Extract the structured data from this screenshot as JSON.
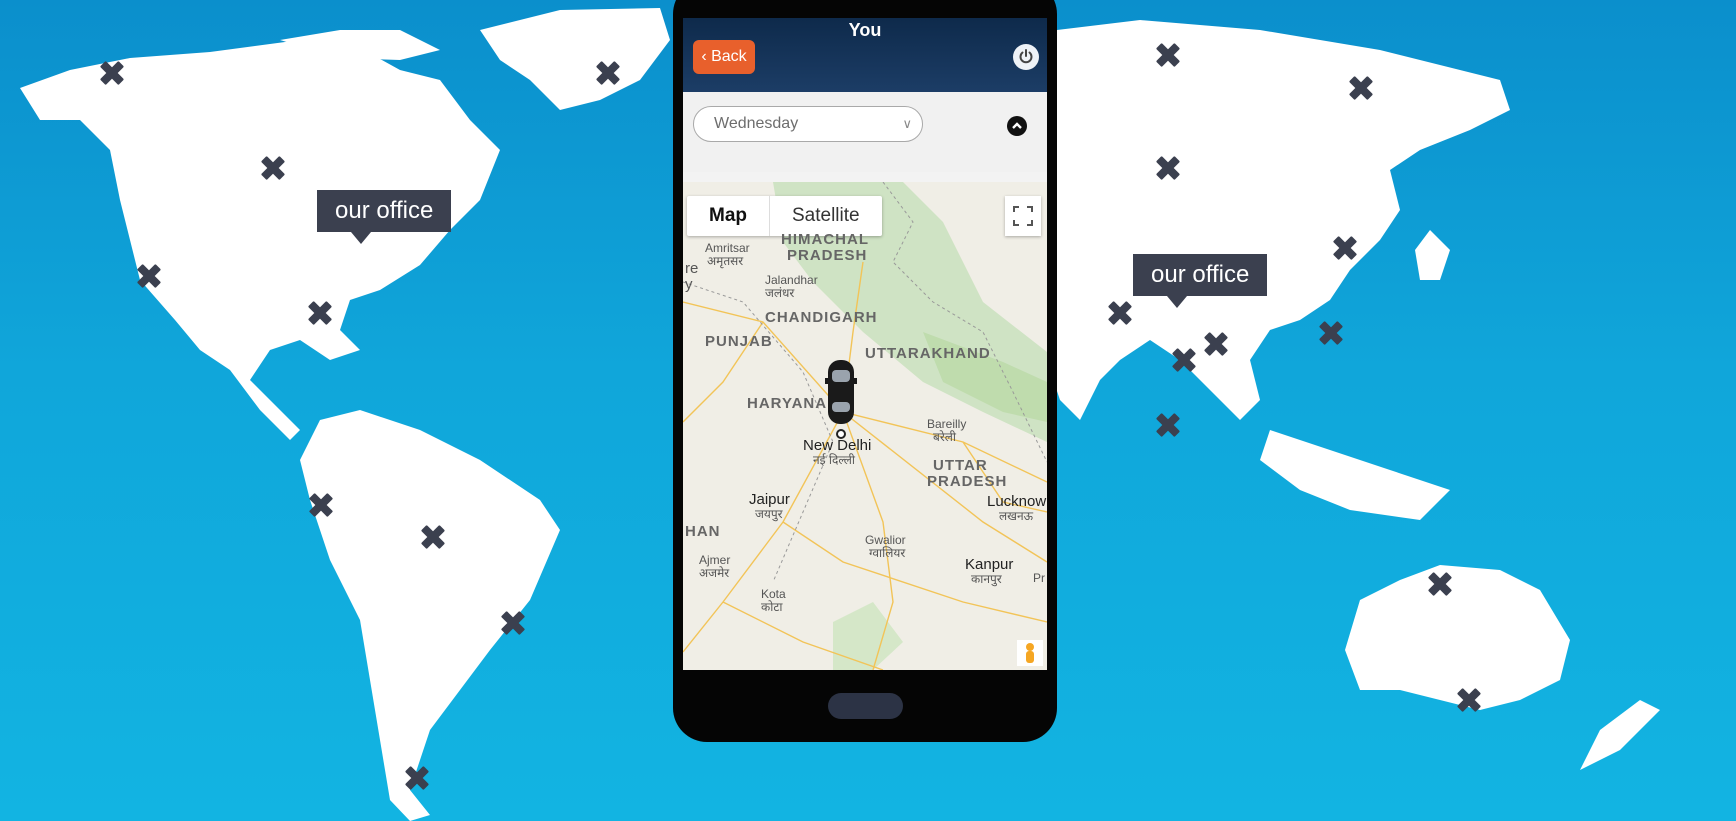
{
  "background": {
    "color_top": "#0b8fcc",
    "color_bottom": "#12b4e2",
    "land_color": "#ffffff",
    "marker_color": "#3b404f"
  },
  "offices": [
    {
      "label": "our office"
    },
    {
      "label": "our office"
    }
  ],
  "app": {
    "title": "You",
    "back_label": "Back",
    "back_icon": "chevron-left-icon",
    "power_icon": "power-icon",
    "day_select": {
      "value": "Wednesday"
    },
    "collapse_icon": "chevron-up-icon"
  },
  "map": {
    "type_buttons": [
      "Map",
      "Satellite"
    ],
    "active_type": "Map",
    "vehicle_icon": "car-icon",
    "places": {
      "himachal": "HIMACHAL",
      "himachal2": "PRADESH",
      "amritsar": "Amritsar",
      "amritsar_hi": "अमृतसर",
      "jalandhar": "Jalandhar",
      "jalandhar_hi": "जलंधर",
      "chandigarh": "CHANDIGARH",
      "punjab": "PUNJAB",
      "uttarakhand": "UTTARAKHAND",
      "haryana": "HARYANA",
      "bareilly": "Bareilly",
      "bareilly_hi": "बरेली",
      "new_delhi": "New Delhi",
      "new_delhi_hi": "नई दिल्ली",
      "uttar": "UTTAR",
      "pradesh": "PRADESH",
      "jaipur": "Jaipur",
      "jaipur_hi": "जयपुर",
      "lucknow": "Lucknow",
      "lucknow_hi": "लखनऊ",
      "han": "HAN",
      "gwalior": "Gwalior",
      "gwalior_hi": "ग्वालियर",
      "ajmer": "Ajmer",
      "ajmer_hi": "अजमेर",
      "kanpur": "Kanpur",
      "kanpur_hi": "कानपुर",
      "kota": "Kota",
      "kota_hi": "कोटा",
      "re": "re",
      "y": "y",
      "pr": "Pr"
    }
  }
}
